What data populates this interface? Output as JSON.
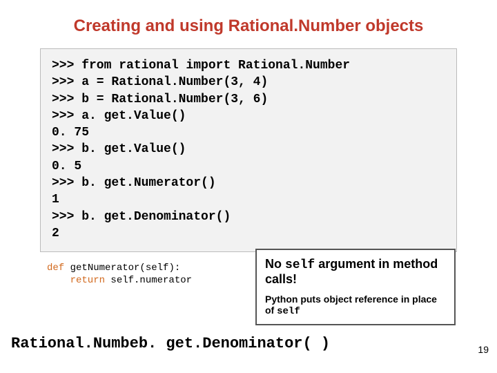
{
  "title": "Creating and using Rational.Number objects",
  "code": ">>> from rational import Rational.Number\n>>> a = Rational.Number(3, 4)\n>>> b = Rational.Number(3, 6)\n>>> a. get.Value()\n0. 75\n>>> b. get.Value()\n0. 5\n>>> b. get.Numerator()\n1\n>>> b. get.Denominator()\n2",
  "def_kw1": "def",
  "def_name": " getNumerator(self):",
  "def_kw2": "    return",
  "def_ret": " self.numerator",
  "callout_line1_pre": "No ",
  "callout_line1_code": "self",
  "callout_line1_post": " argument in method calls!",
  "callout_line2_pre": "Python puts object reference in place of ",
  "callout_line2_code": "self",
  "bottom": "Rational.Numbeb. get.Denominator( )",
  "page": "19"
}
